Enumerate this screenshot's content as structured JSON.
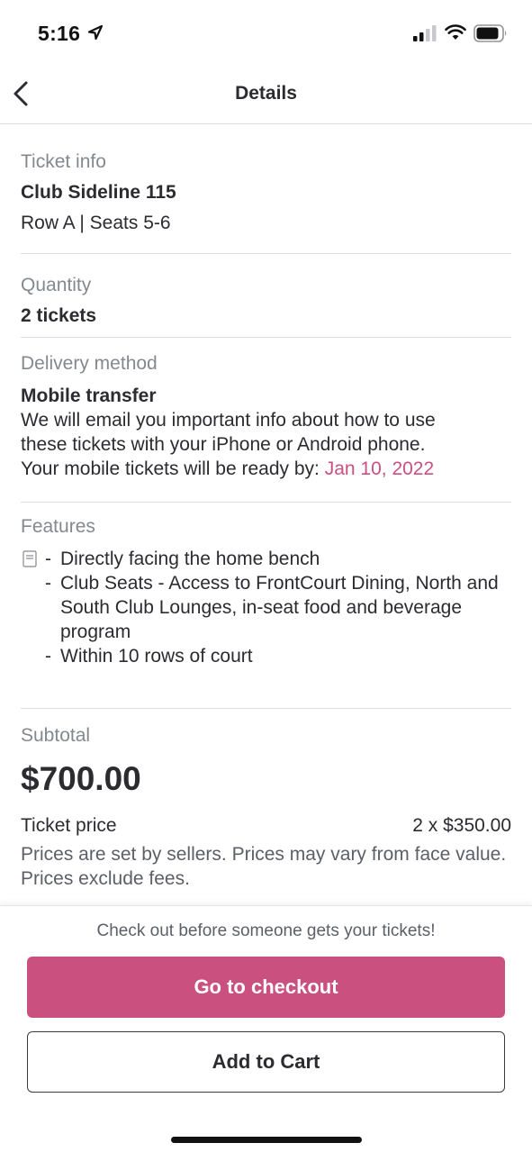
{
  "status_bar": {
    "time": "5:16",
    "icons": [
      "location-arrow-icon",
      "cellular-signal-icon",
      "wifi-icon",
      "battery-icon"
    ]
  },
  "header": {
    "title": "Details",
    "back_icon": "chevron-left-icon"
  },
  "ticket_info": {
    "label": "Ticket info",
    "section_name": "Club Sideline 115",
    "row_seats": "Row A | Seats 5-6"
  },
  "quantity": {
    "label": "Quantity",
    "value": "2 tickets"
  },
  "delivery": {
    "label": "Delivery method",
    "method": "Mobile transfer",
    "line1": "We will email you important info about how to use",
    "line2": "these tickets with your iPhone or Android phone.",
    "ready_prefix": "Your mobile tickets will be ready by: ",
    "ready_date": "Jan 10, 2022"
  },
  "features": {
    "label": "Features",
    "icon": "document-icon",
    "items": [
      "Directly facing the home bench",
      "Club Seats - Access to FrontCourt Dining, North and South Club Lounges, in-seat food and beverage program",
      "Within 10 rows of court"
    ]
  },
  "subtotal": {
    "label": "Subtotal",
    "amount": "$700.00",
    "ticket_price_label": "Ticket price",
    "ticket_price_value": "2 x $350.00",
    "note": "Prices are set by sellers. Prices may vary from face value. Prices exclude fees."
  },
  "actions": {
    "urgency_text": "Check out before someone gets your tickets!",
    "checkout_label": "Go to checkout",
    "cart_label": "Add to Cart"
  },
  "colors": {
    "accent": "#c9507f",
    "text": "#2b2b30",
    "muted": "#84888f",
    "divider": "#dcdcdc"
  }
}
